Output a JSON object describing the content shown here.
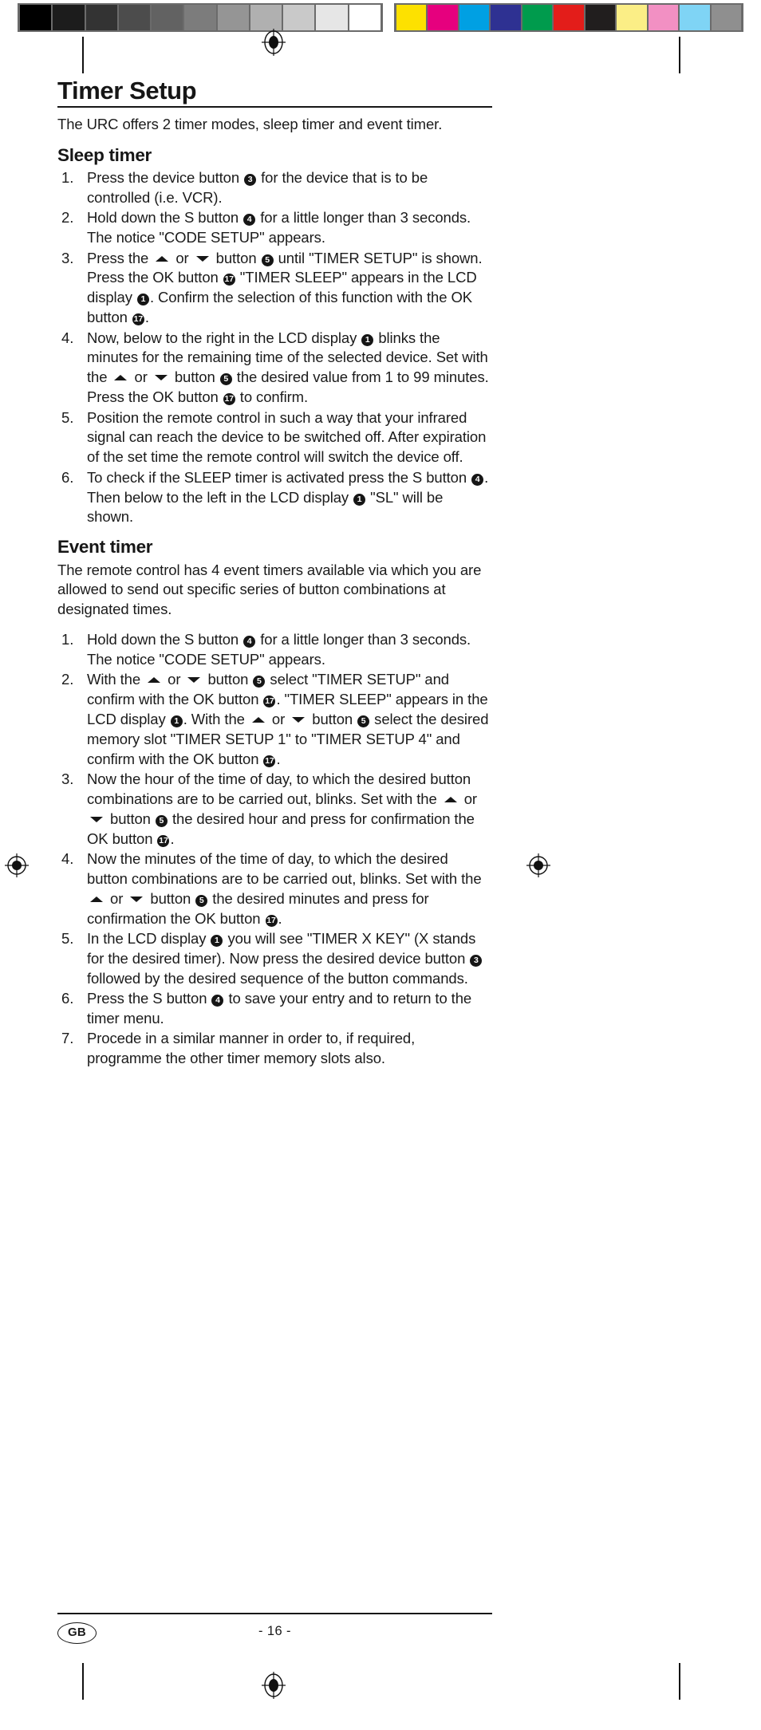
{
  "calibration": {
    "grayscale_swatches": [
      "#000000",
      "#1c1c1c",
      "#333333",
      "#4c4c4c",
      "#626262",
      "#7c7c7c",
      "#959595",
      "#b0b0b0",
      "#c9c9c9",
      "#e6e6e6",
      "#ffffff"
    ],
    "color_swatches": [
      "#fde100",
      "#e6007e",
      "#00a0e3",
      "#2e3192",
      "#009b4d",
      "#e31d1a",
      "#211e1e",
      "#fbee86",
      "#f290c3",
      "#7fd4f5",
      "#8f8f8f"
    ],
    "bar_frame_color": "#6b6b6b"
  },
  "marks": {
    "registration_icon": "registration-target-icon",
    "crop_mark_color": "#111111"
  },
  "document": {
    "title": "Timer Setup",
    "lead": "The URC offers 2 timer modes, sleep timer and event timer."
  },
  "sections": [
    {
      "heading": "Sleep timer",
      "steps": [
        {
          "number": "1.",
          "parts": [
            {
              "t": "text",
              "v": "Press the device button "
            },
            {
              "t": "ref",
              "v": "3"
            },
            {
              "t": "text",
              "v": " for the device that is to be controlled (i.e. VCR)."
            }
          ]
        },
        {
          "number": "2.",
          "parts": [
            {
              "t": "text",
              "v": "Hold down the S button "
            },
            {
              "t": "ref",
              "v": "4"
            },
            {
              "t": "text",
              "v": " for a little longer than 3 seconds. The notice \"CODE SETUP\" appears."
            }
          ]
        },
        {
          "number": "3.",
          "parts": [
            {
              "t": "text",
              "v": "Press the "
            },
            {
              "t": "arrow-up",
              "v": "▲"
            },
            {
              "t": "text",
              "v": " or "
            },
            {
              "t": "arrow-down",
              "v": "▼"
            },
            {
              "t": "text",
              "v": " button "
            },
            {
              "t": "ref",
              "v": "5"
            },
            {
              "t": "text",
              "v": " until \"TIMER SETUP\" is shown. Press the OK button "
            },
            {
              "t": "ref",
              "v": "17"
            },
            {
              "t": "text",
              "v": " \"TIMER SLEEP\" appears in the LCD display "
            },
            {
              "t": "ref",
              "v": "1"
            },
            {
              "t": "text",
              "v": ".  Confirm the selection of this function with the OK button "
            },
            {
              "t": "ref",
              "v": "17"
            },
            {
              "t": "text",
              "v": "."
            }
          ]
        },
        {
          "number": "4.",
          "parts": [
            {
              "t": "text",
              "v": "Now, below to the right in the LCD display "
            },
            {
              "t": "ref",
              "v": "1"
            },
            {
              "t": "text",
              "v": " blinks the minutes for the remaining time of the selected device. Set with the "
            },
            {
              "t": "arrow-up",
              "v": "▲"
            },
            {
              "t": "text",
              "v": " or "
            },
            {
              "t": "arrow-down",
              "v": "▼"
            },
            {
              "t": "text",
              "v": " button "
            },
            {
              "t": "ref",
              "v": "5"
            },
            {
              "t": "text",
              "v": " the desired value from 1 to 99 minutes. Press the OK button "
            },
            {
              "t": "ref",
              "v": "17"
            },
            {
              "t": "text",
              "v": " to confirm."
            }
          ]
        },
        {
          "number": "5.",
          "parts": [
            {
              "t": "text",
              "v": "Position the remote control in such a way that your infrared signal can reach the device to be switched off. After expiration of the set time the remote control will switch the device off."
            }
          ]
        },
        {
          "number": "6.",
          "parts": [
            {
              "t": "text",
              "v": "To check if the SLEEP timer is activated press the S button "
            },
            {
              "t": "ref",
              "v": "4"
            },
            {
              "t": "text",
              "v": ". Then below to the left in the LCD display "
            },
            {
              "t": "ref",
              "v": "1"
            },
            {
              "t": "text",
              "v": " \"SL\" will be shown."
            }
          ]
        }
      ]
    },
    {
      "heading": "Event timer",
      "lead": "The remote control has 4 event timers available via which you are allowed to send out specific series of button combinations at designated times.",
      "steps": [
        {
          "number": "1.",
          "parts": [
            {
              "t": "text",
              "v": "Hold down the S button "
            },
            {
              "t": "ref",
              "v": "4"
            },
            {
              "t": "text",
              "v": " for a little longer than 3 seconds. The notice \"CODE SETUP\" appears."
            }
          ]
        },
        {
          "number": "2.",
          "parts": [
            {
              "t": "text",
              "v": "With the "
            },
            {
              "t": "arrow-up",
              "v": "▲"
            },
            {
              "t": "text",
              "v": " or "
            },
            {
              "t": "arrow-down",
              "v": "▼"
            },
            {
              "t": "text",
              "v": " button "
            },
            {
              "t": "ref",
              "v": "5"
            },
            {
              "t": "text",
              "v": " select \"TIMER SETUP\" and confirm with the OK button "
            },
            {
              "t": "ref",
              "v": "17"
            },
            {
              "t": "text",
              "v": ". \"TIMER SLEEP\" appears in the LCD display "
            },
            {
              "t": "ref",
              "v": "1"
            },
            {
              "t": "text",
              "v": ".  With the "
            },
            {
              "t": "arrow-up",
              "v": "▲"
            },
            {
              "t": "text",
              "v": " or "
            },
            {
              "t": "arrow-down",
              "v": "▼"
            },
            {
              "t": "text",
              "v": " button "
            },
            {
              "t": "ref",
              "v": "5"
            },
            {
              "t": "text",
              "v": " select the desired memory slot \"TIMER SETUP 1\" to \"TIMER SETUP 4\" and confirm with the OK button "
            },
            {
              "t": "ref",
              "v": "17"
            },
            {
              "t": "text",
              "v": "."
            }
          ]
        },
        {
          "number": "3.",
          "parts": [
            {
              "t": "text",
              "v": "Now the hour of the time of day, to which the desired button combinations are to be carried out, blinks. Set with the "
            },
            {
              "t": "arrow-up",
              "v": "▲"
            },
            {
              "t": "text",
              "v": " or "
            },
            {
              "t": "arrow-down",
              "v": "▼"
            },
            {
              "t": "text",
              "v": " button "
            },
            {
              "t": "ref",
              "v": "5"
            },
            {
              "t": "text",
              "v": " the desired hour and press for confirmation the OK button "
            },
            {
              "t": "ref",
              "v": "17"
            },
            {
              "t": "text",
              "v": "."
            }
          ]
        },
        {
          "number": "4.",
          "parts": [
            {
              "t": "text",
              "v": "Now the minutes of the time of day, to which the desired button combinations are to be carried out, blinks. Set with the "
            },
            {
              "t": "arrow-up",
              "v": "▲"
            },
            {
              "t": "text",
              "v": " or "
            },
            {
              "t": "arrow-down",
              "v": "▼"
            },
            {
              "t": "text",
              "v": " button "
            },
            {
              "t": "ref",
              "v": "5"
            },
            {
              "t": "text",
              "v": " the desired minutes and press for confirmation the OK button "
            },
            {
              "t": "ref",
              "v": "17"
            },
            {
              "t": "text",
              "v": "."
            }
          ]
        },
        {
          "number": "5.",
          "parts": [
            {
              "t": "text",
              "v": "In the LCD display "
            },
            {
              "t": "ref",
              "v": "1"
            },
            {
              "t": "text",
              "v": " you will see \"TIMER X KEY\" (X stands for the desired timer). Now press the desired device button "
            },
            {
              "t": "ref",
              "v": "3"
            },
            {
              "t": "text",
              "v": " followed by the desired sequence of the button commands."
            }
          ]
        },
        {
          "number": "6.",
          "parts": [
            {
              "t": "text",
              "v": "Press the S button "
            },
            {
              "t": "ref",
              "v": "4"
            },
            {
              "t": "text",
              "v": " to save your entry and to return to the timer menu."
            }
          ]
        },
        {
          "number": "7.",
          "parts": [
            {
              "t": "text",
              "v": "Procede in a similar manner in order to, if required, programme the other timer memory slots also."
            }
          ]
        }
      ]
    }
  ],
  "footer": {
    "language_badge": "GB",
    "page_number": "- 16 -"
  }
}
